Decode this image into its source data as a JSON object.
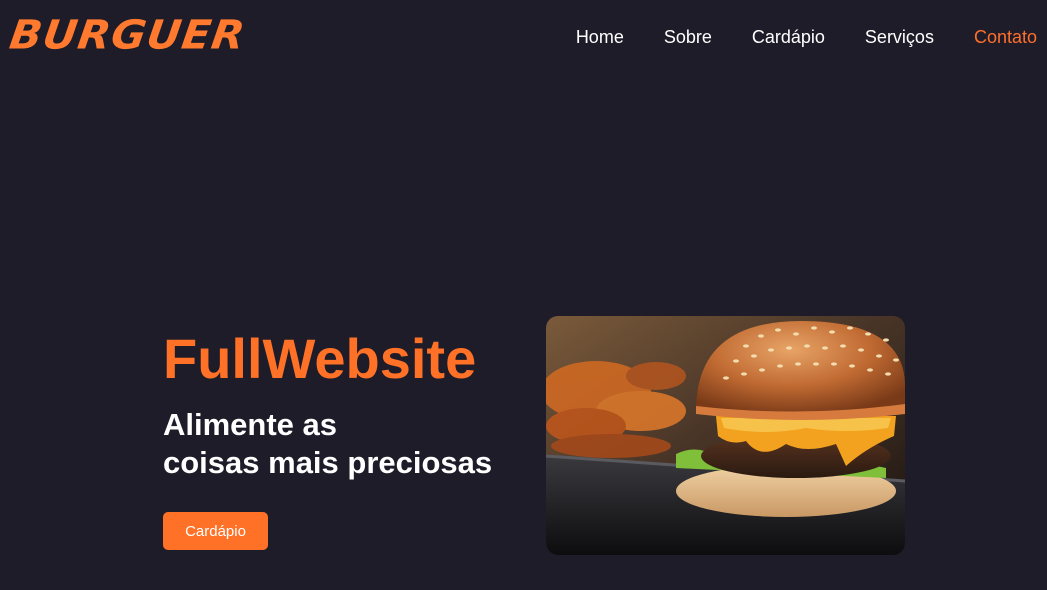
{
  "header": {
    "logo_text": "BURGUER",
    "nav": [
      {
        "label": "Home",
        "active": false
      },
      {
        "label": "Sobre",
        "active": false
      },
      {
        "label": "Cardápio",
        "active": false
      },
      {
        "label": "Serviços",
        "active": false
      },
      {
        "label": "Contato",
        "active": true
      }
    ]
  },
  "hero": {
    "title": "FullWebsite",
    "subtitle_line1": "Alimente as",
    "subtitle_line2": "coisas mais preciosas",
    "button_label": "Cardápio",
    "image": "burger-photo"
  },
  "colors": {
    "background": "#1e1c29",
    "accent": "#ff7126",
    "text": "#ffffff"
  }
}
